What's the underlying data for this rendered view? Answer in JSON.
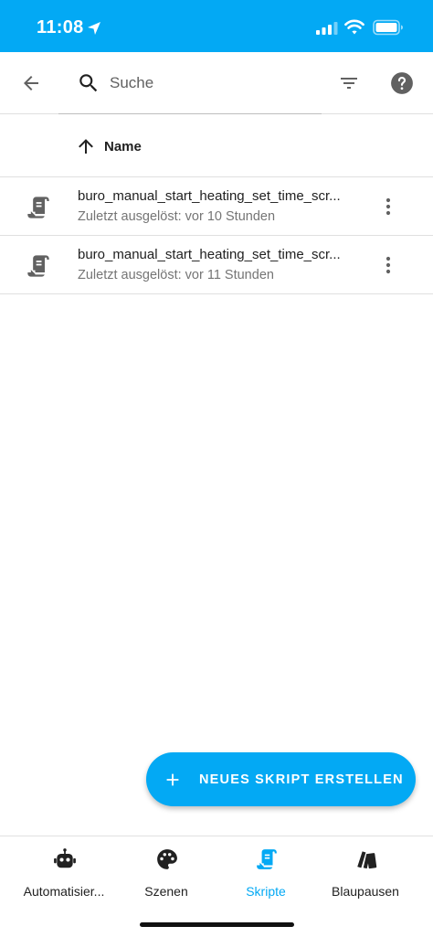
{
  "status_bar": {
    "time": "11:08",
    "background": "#03a9f4"
  },
  "toolbar": {
    "back_icon": "arrow-left-icon",
    "search_placeholder": "Suche",
    "search_value": "",
    "filter_icon": "filter-icon",
    "help_icon": "help-circle-icon"
  },
  "sort_header": {
    "icon": "arrow-up-icon",
    "label": "Name"
  },
  "scripts": [
    {
      "title": "buro_manual_start_heating_set_time_scr...",
      "subtitle": "Zuletzt ausgelöst: vor 10 Stunden",
      "icon": "script-text-icon"
    },
    {
      "title": "buro_manual_start_heating_set_time_scr...",
      "subtitle": "Zuletzt ausgelöst: vor 11 Stunden",
      "icon": "script-text-icon"
    }
  ],
  "fab": {
    "label": "NEUES SKRIPT ERSTELLEN",
    "icon": "plus-icon"
  },
  "bottom_nav": {
    "items": [
      {
        "label": "Automatisier...",
        "icon": "robot-icon",
        "active": false
      },
      {
        "label": "Szenen",
        "icon": "palette-icon",
        "active": false
      },
      {
        "label": "Skripte",
        "icon": "script-text-icon",
        "active": true
      },
      {
        "label": "Blaupausen",
        "icon": "blueprint-icon",
        "active": false
      }
    ]
  },
  "colors": {
    "accent": "#03a9f4",
    "text_primary": "#212121",
    "text_secondary": "#757575",
    "icon": "#616161",
    "divider": "#e0e0e0"
  }
}
